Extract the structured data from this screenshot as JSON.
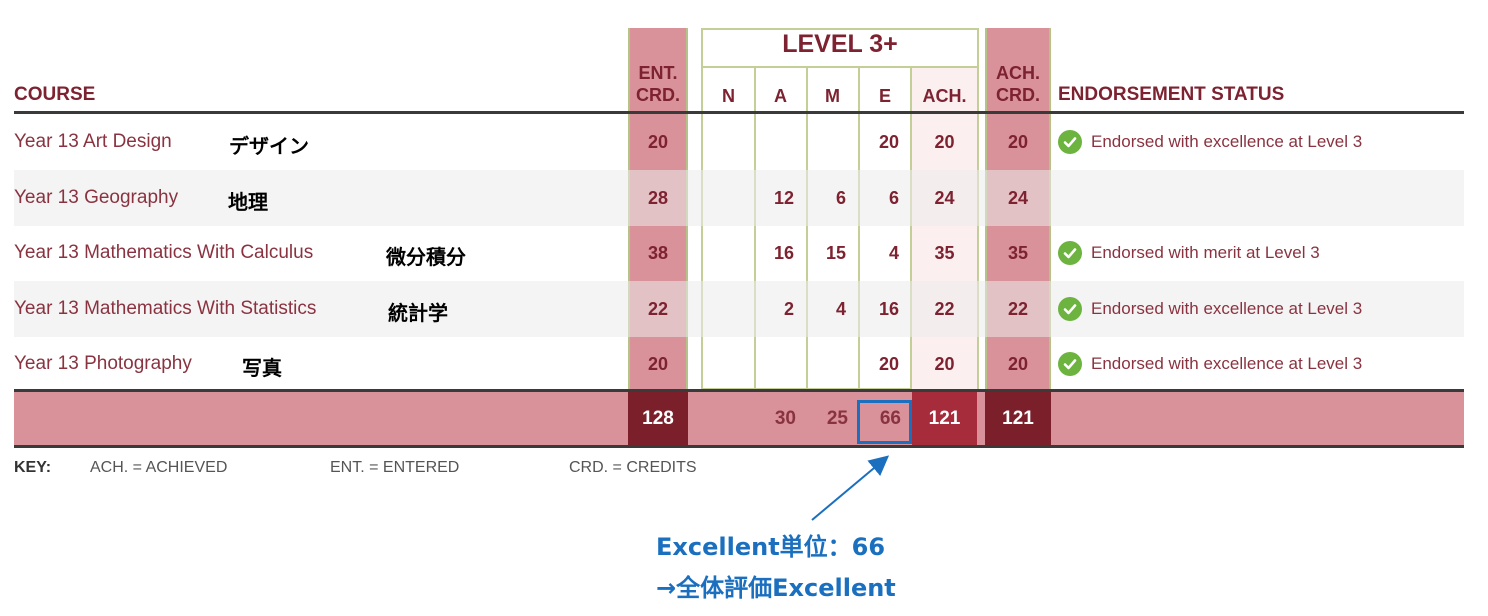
{
  "header": {
    "course": "COURSE",
    "ent_crd": [
      "ENT.",
      "CRD."
    ],
    "level": "LEVEL 3+",
    "level_cols": [
      "N",
      "A",
      "M",
      "E",
      "ACH."
    ],
    "ach_crd": [
      "ACH.",
      "CRD."
    ],
    "endorsement": "ENDORSEMENT STATUS"
  },
  "rows": [
    {
      "course": "Year 13 Art Design",
      "jp": "デザイン",
      "ent": "20",
      "n": "",
      "a": "",
      "m": "",
      "e": "20",
      "ach": "20",
      "ach_crd": "20",
      "status": "Endorsed with excellence at Level 3",
      "endorsed": true
    },
    {
      "course": "Year 13 Geography",
      "jp": "地理",
      "ent": "28",
      "n": "",
      "a": "12",
      "m": "6",
      "e": "6",
      "ach": "24",
      "ach_crd": "24",
      "status": "",
      "endorsed": false
    },
    {
      "course": "Year 13 Mathematics With Calculus",
      "jp": "微分積分",
      "ent": "38",
      "n": "",
      "a": "16",
      "m": "15",
      "e": "4",
      "ach": "35",
      "ach_crd": "35",
      "status": "Endorsed with merit at Level 3",
      "endorsed": true
    },
    {
      "course": "Year 13 Mathematics With Statistics",
      "jp": "統計学",
      "ent": "22",
      "n": "",
      "a": "2",
      "m": "4",
      "e": "16",
      "ach": "22",
      "ach_crd": "22",
      "status": "Endorsed with excellence at Level 3",
      "endorsed": true
    },
    {
      "course": "Year 13 Photography",
      "jp": "写真",
      "ent": "20",
      "n": "",
      "a": "",
      "m": "",
      "e": "20",
      "ach": "20",
      "ach_crd": "20",
      "status": "Endorsed with excellence at Level 3",
      "endorsed": true
    }
  ],
  "totals": {
    "ent": "128",
    "n": "",
    "a": "30",
    "m": "25",
    "e": "66",
    "ach": "121",
    "ach_crd": "121"
  },
  "key": {
    "label": "KEY:",
    "items": [
      "ACH. = ACHIEVED",
      "ENT. = ENTERED",
      "CRD. = CREDITS"
    ]
  },
  "annotation": {
    "line1": "Excellent単位：66",
    "line2": "→全体評価Excellent",
    "color": "#1a6fbf"
  },
  "colors": {
    "maroon": "#7d2230",
    "column_pink": "#d9919a",
    "total_dark": "#7b1f2a",
    "check_green": "#6cb33f"
  }
}
